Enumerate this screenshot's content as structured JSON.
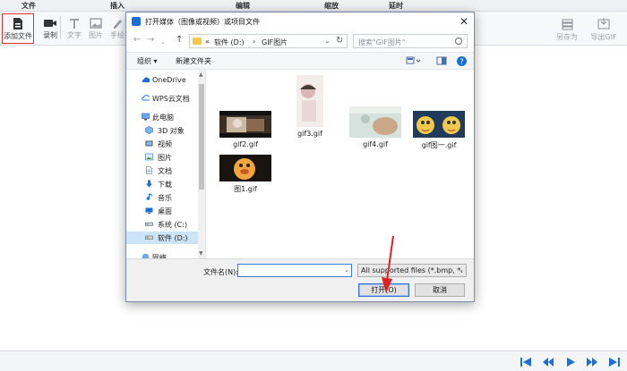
{
  "app": {
    "tabs": [
      "文件",
      "插入",
      "编辑",
      "缩放",
      "延时"
    ],
    "ribbon": {
      "add_file": "添加文件",
      "record": "录制",
      "text": "文字",
      "image": "图片",
      "handdraw": "手绘",
      "save_as": "另存为",
      "export_gif": "导出GIF"
    }
  },
  "dialog": {
    "title": "打开媒体（图像或视频）或项目文件",
    "close": "✕",
    "address": {
      "prefix": "«",
      "crumbs": [
        "软件 (D:)",
        "GIF图片"
      ],
      "separator": "›"
    },
    "search_placeholder": "搜索\"GIF图片\"",
    "commands": {
      "organize": "组织 ▾",
      "new_folder": "新建文件夹"
    },
    "nav_items": [
      {
        "label": "OneDrive",
        "icon": "cloud-icon"
      },
      {
        "label": "WPS云文档",
        "icon": "cloud-icon"
      },
      {
        "label": "此电脑",
        "icon": "computer-icon"
      },
      {
        "label": "3D 对象",
        "icon": "cube-icon"
      },
      {
        "label": "视频",
        "icon": "video-icon"
      },
      {
        "label": "图片",
        "icon": "picture-icon"
      },
      {
        "label": "文档",
        "icon": "document-icon"
      },
      {
        "label": "下载",
        "icon": "download-icon"
      },
      {
        "label": "音乐",
        "icon": "music-icon"
      },
      {
        "label": "桌面",
        "icon": "desktop-icon"
      },
      {
        "label": "系统 (C:)",
        "icon": "drive-icon"
      },
      {
        "label": "软件 (D:)",
        "icon": "drive-icon",
        "selected": true
      },
      {
        "label": "网络",
        "icon": "network-icon"
      }
    ],
    "files": [
      {
        "name": "gif2.gif"
      },
      {
        "name": "gif3.gif"
      },
      {
        "name": "gif4.gif"
      },
      {
        "name": "gif图一.gif"
      },
      {
        "name": "图1.gif"
      }
    ],
    "filename_label": "文件名(N):",
    "filename_value": "",
    "filetype_value": "All supported files (*.bmp, *.",
    "open_button": "打开(O)",
    "cancel_button": "取消"
  },
  "colors": {
    "accent": "#1a6fd6",
    "annotation": "#e02020",
    "selected": "#cce4f7"
  }
}
